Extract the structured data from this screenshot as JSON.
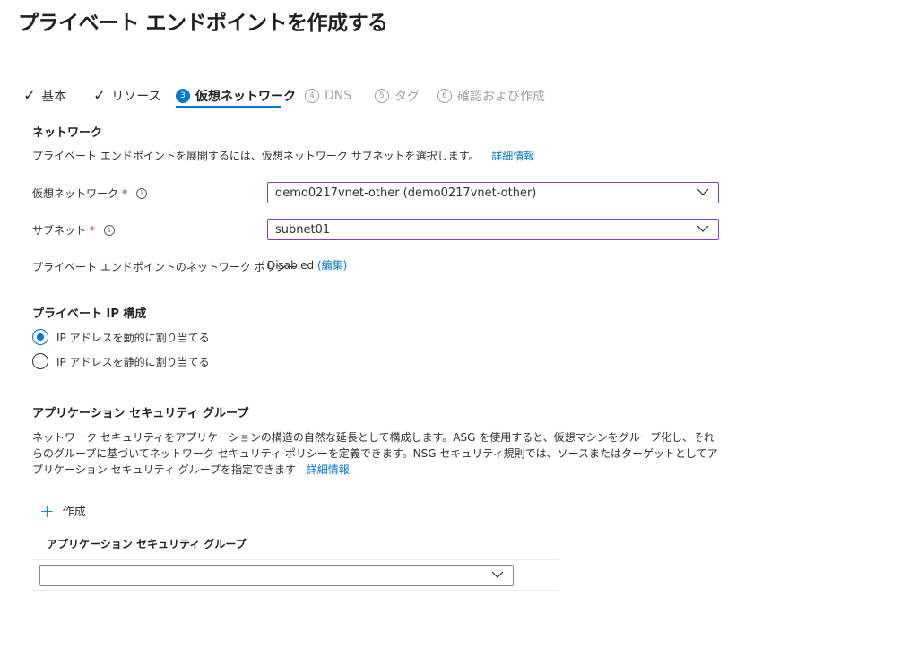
{
  "page": {
    "title": "プライベート エンドポイントを作成する",
    "more": "···"
  },
  "tabs": [
    {
      "label": "基本",
      "state": "done"
    },
    {
      "label": "リソース",
      "state": "done"
    },
    {
      "label": "仮想ネットワーク",
      "num": "3",
      "state": "active"
    },
    {
      "label": "DNS",
      "num": "4",
      "state": "disabled"
    },
    {
      "label": "タグ",
      "num": "5",
      "state": "disabled"
    },
    {
      "label": "確認および作成",
      "num": "6",
      "state": "disabled"
    }
  ],
  "network": {
    "heading": "ネットワーク",
    "description": "プライベート エンドポイントを展開するには、仮想ネットワーク サブネットを選択します。",
    "learn_more": "詳細情報",
    "vnet_label": "仮想ネットワーク",
    "vnet_value": "demo0217vnet-other (demo0217vnet-other)",
    "subnet_label": "サブネット",
    "subnet_value": "subnet01",
    "policy_label": "プライベート エンドポイントのネットワーク ポリシー",
    "policy_value": "Disabled",
    "policy_edit": "(編集)",
    "required_mark": "*",
    "info_glyph": "i"
  },
  "private_ip": {
    "heading": "プライベート IP 構成",
    "option_dynamic": "IP アドレスを動的に割り当てる",
    "option_static": "IP アドレスを静的に割り当てる",
    "selected": "dynamic"
  },
  "asg": {
    "heading": "アプリケーション セキュリティ グループ",
    "description": "ネットワーク セキュリティをアプリケーションの構造の自然な延長として構成します。ASG を使用すると、仮想マシンをグループ化し、それらのグループに基づいてネットワーク セキュリティ ポリシーを定義できます。NSG セキュリティ規則では、ソースまたはターゲットとしてアプリケーション セキュリティ グループを指定できます",
    "learn_more": "詳細情報",
    "create_label": "作成",
    "column_header": "アプリケーション セキュリティ グループ",
    "select_value": ""
  },
  "colors": {
    "accent": "#0078d4",
    "required": "#a4262c",
    "focus_border": "#8a3db8"
  }
}
